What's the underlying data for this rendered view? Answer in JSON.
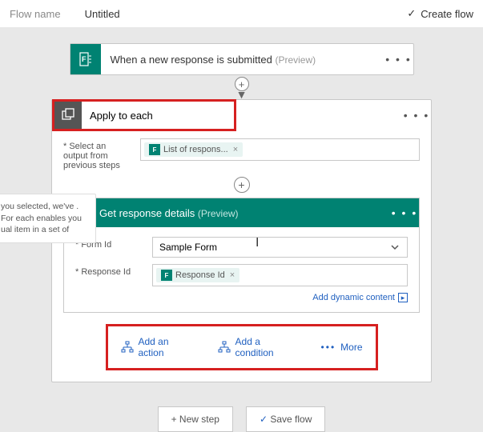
{
  "topbar": {
    "label": "Flow name",
    "title": "Untitled",
    "create": "Create flow"
  },
  "trigger": {
    "title": "When a new response is submitted",
    "preview": "(Preview)"
  },
  "apply": {
    "title": "Apply to each",
    "select_label": "* Select an output from previous steps",
    "token_label": "List of respons...",
    "nested": {
      "title": "Get response details",
      "preview": "(Preview)",
      "form_id_label": "* Form Id",
      "form_value": "Sample Form",
      "response_id_label": "* Response Id",
      "response_token": "Response Id",
      "dynamic_content": "Add dynamic content"
    },
    "actions": {
      "add_action": "Add an action",
      "add_condition": "Add a condition",
      "more": "More"
    }
  },
  "bottom": {
    "new_step": "+ New step",
    "save": "Save flow"
  },
  "tooltip": {
    "text": "you selected, we've . For each enables you ual item in a set of"
  }
}
